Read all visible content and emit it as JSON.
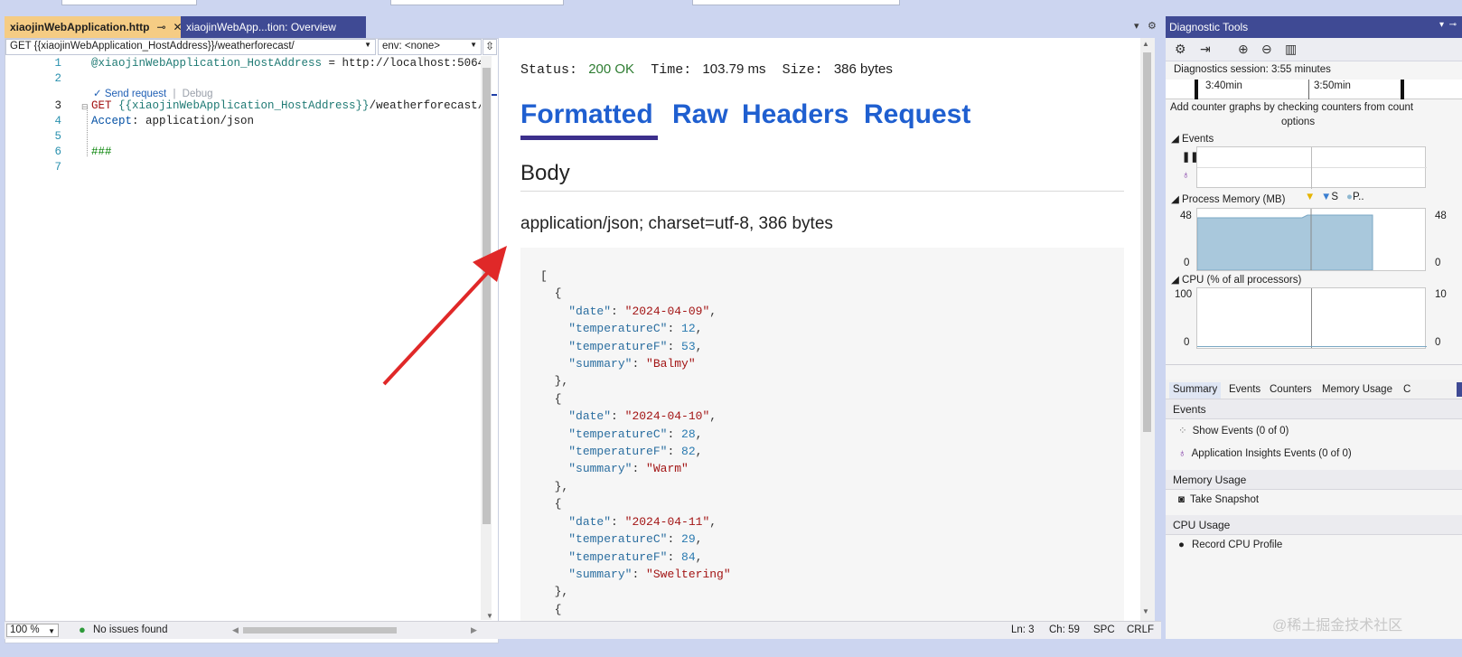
{
  "tabs": [
    {
      "label": "xiaojinWebApplication.http",
      "active": true,
      "pin": "⊸",
      "close": "✕"
    },
    {
      "label": "xiaojinWebApp...tion: Overview",
      "active": false
    }
  ],
  "editor": {
    "request_combo": "GET {{xiaojinWebApplication_HostAddress}}/weatherforecast/",
    "env_combo": "env: <none>",
    "codelens": {
      "send": "Send request",
      "sep": "|",
      "debug": "Debug"
    },
    "line_numbers": [
      "1",
      "2",
      "3",
      "4",
      "5",
      "6",
      "7"
    ],
    "lines": {
      "l1_var": "@xiaojinWebApplication_HostAddress",
      "l1_rest": " = http://localhost:5064",
      "l3_method": "GET ",
      "l3_var": "{{xiaojinWebApplication_HostAddress}}",
      "l3_path": "/weatherforecast/",
      "l4_key": "Accept",
      "l4_val": ": application/json",
      "l6": "###"
    }
  },
  "preview": {
    "status_label": "Status:",
    "status_value": "200 OK",
    "time_label": "Time:",
    "time_value": "103.79 ms",
    "size_label": "Size:",
    "size_value": "386 bytes",
    "tabs": [
      "Formatted",
      "Raw",
      "Headers",
      "Request"
    ],
    "body_title": "Body",
    "content_type": "application/json; charset=utf-8, 386 bytes",
    "json": [
      {
        "date": "2024-04-09",
        "temperatureC": 12,
        "temperatureF": 53,
        "summary": "Balmy"
      },
      {
        "date": "2024-04-10",
        "temperatureC": 28,
        "temperatureF": 82,
        "summary": "Warm"
      },
      {
        "date": "2024-04-11",
        "temperatureC": 29,
        "temperatureF": 84,
        "summary": "Sweltering"
      }
    ]
  },
  "statusbar": {
    "zoom": "100 %",
    "issues": "No issues found",
    "ln": "Ln: 3",
    "ch": "Ch: 59",
    "spc": "SPC",
    "crlf": "CRLF"
  },
  "diagnostics": {
    "title": "Diagnostic Tools",
    "session": "Diagnostics session: 3:55 minutes",
    "time_ticks": [
      "3:40min",
      "3:50min"
    ],
    "add_counter_line1": "Add counter graphs by checking counters from count",
    "add_counter_line2": "options",
    "events_label": "Events",
    "memory_label": "Process Memory (MB)",
    "memory_legend": [
      "S",
      "P.."
    ],
    "memory_max": "48",
    "memory_min": "0",
    "memory_level": 0.9,
    "cpu_label": "CPU (% of all processors)",
    "cpu_max": "100",
    "cpu_max_right": "10",
    "cpu_min": "0",
    "tabs": [
      "Summary",
      "Events",
      "Counters",
      "Memory Usage",
      "C"
    ],
    "sections": {
      "events": "Events",
      "show_events": "Show Events (0 of 0)",
      "ai_events": "Application Insights Events (0 of 0)",
      "memory": "Memory Usage",
      "snapshot": "Take Snapshot",
      "cpu": "CPU Usage",
      "record": "Record CPU Profile"
    }
  },
  "watermark": "@稀土掘金技术社区",
  "colors": {
    "accent_tab": "#f5cc84",
    "title_bar": "#3f4a94",
    "link_blue": "#1f5fd0",
    "ok_green": "#2e7d32",
    "arrow_red": "#e02828"
  }
}
